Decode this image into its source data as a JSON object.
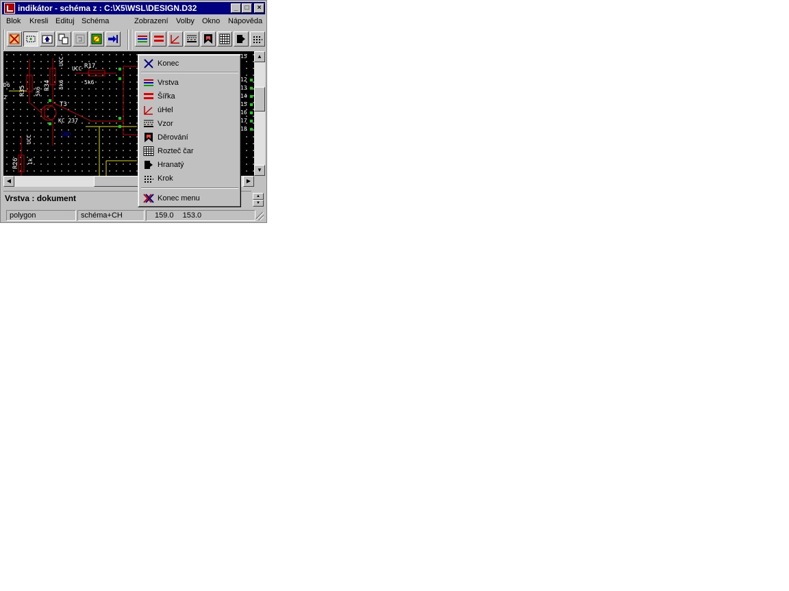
{
  "window": {
    "title": "indikátor - schéma z : C:\\X5\\WSL\\DESIGN.D32",
    "controls": {
      "minimize": "_",
      "maximize": "□",
      "close": "×"
    }
  },
  "menubar": {
    "items": [
      "Blok",
      "Kresli",
      "Edituj",
      "Schéma",
      "Zobrazení",
      "Volby",
      "Okno",
      "Nápověda"
    ]
  },
  "toolbar": {
    "icons": [
      "cancel-icon",
      "select-icon",
      "upload-icon",
      "copy-icon",
      "undo-icon",
      "image-icon",
      "import-icon",
      "layers-icon",
      "width-icon",
      "angle-icon",
      "pattern-icon",
      "drill-icon",
      "grid-icon",
      "square-icon",
      "step-icon"
    ]
  },
  "schematic": {
    "labels": {
      "ucc1": "UCC",
      "ucc2": "UCC",
      "ucc3": "UCC",
      "r17": "R17",
      "r17v": "5k6",
      "r34": "R34",
      "r34v": "5k6",
      "r35": "R35",
      "r35v": "5k6",
      "r26": "R26",
      "r26v": "1k",
      "t3": "T3",
      "t3part": "KC 237",
      "gnd": "GND",
      "left6": "D6",
      "left2": "2",
      "n15": "15",
      "n2b": "2",
      "n12": "12",
      "n13": "13",
      "n14": "14",
      "n15b": "15",
      "n16": "16",
      "n17": "17",
      "n18": "18"
    }
  },
  "popup": {
    "items": [
      {
        "label": "Konec",
        "icon": "close-x-icon",
        "underline": "K"
      },
      {
        "label": "Vrstva",
        "icon": "layers-icon"
      },
      {
        "label": "Šířka",
        "icon": "width-icon"
      },
      {
        "label": "úHel",
        "icon": "angle-icon"
      },
      {
        "label": "Vzor",
        "icon": "pattern-icon"
      },
      {
        "label": "Děrování",
        "icon": "drill-icon"
      },
      {
        "label": "Rozteč čar",
        "icon": "grid-icon"
      },
      {
        "label": "Hranatý",
        "icon": "square-icon"
      },
      {
        "label": "Krok",
        "icon": "step-icon"
      },
      {
        "label": "Konec menu",
        "icon": "close-menu-icon"
      }
    ]
  },
  "info": {
    "text": "Vrstva : dokument"
  },
  "status": {
    "mode": "polygon",
    "layer": "schéma+CH",
    "x": "159.0",
    "y": "153.0"
  }
}
